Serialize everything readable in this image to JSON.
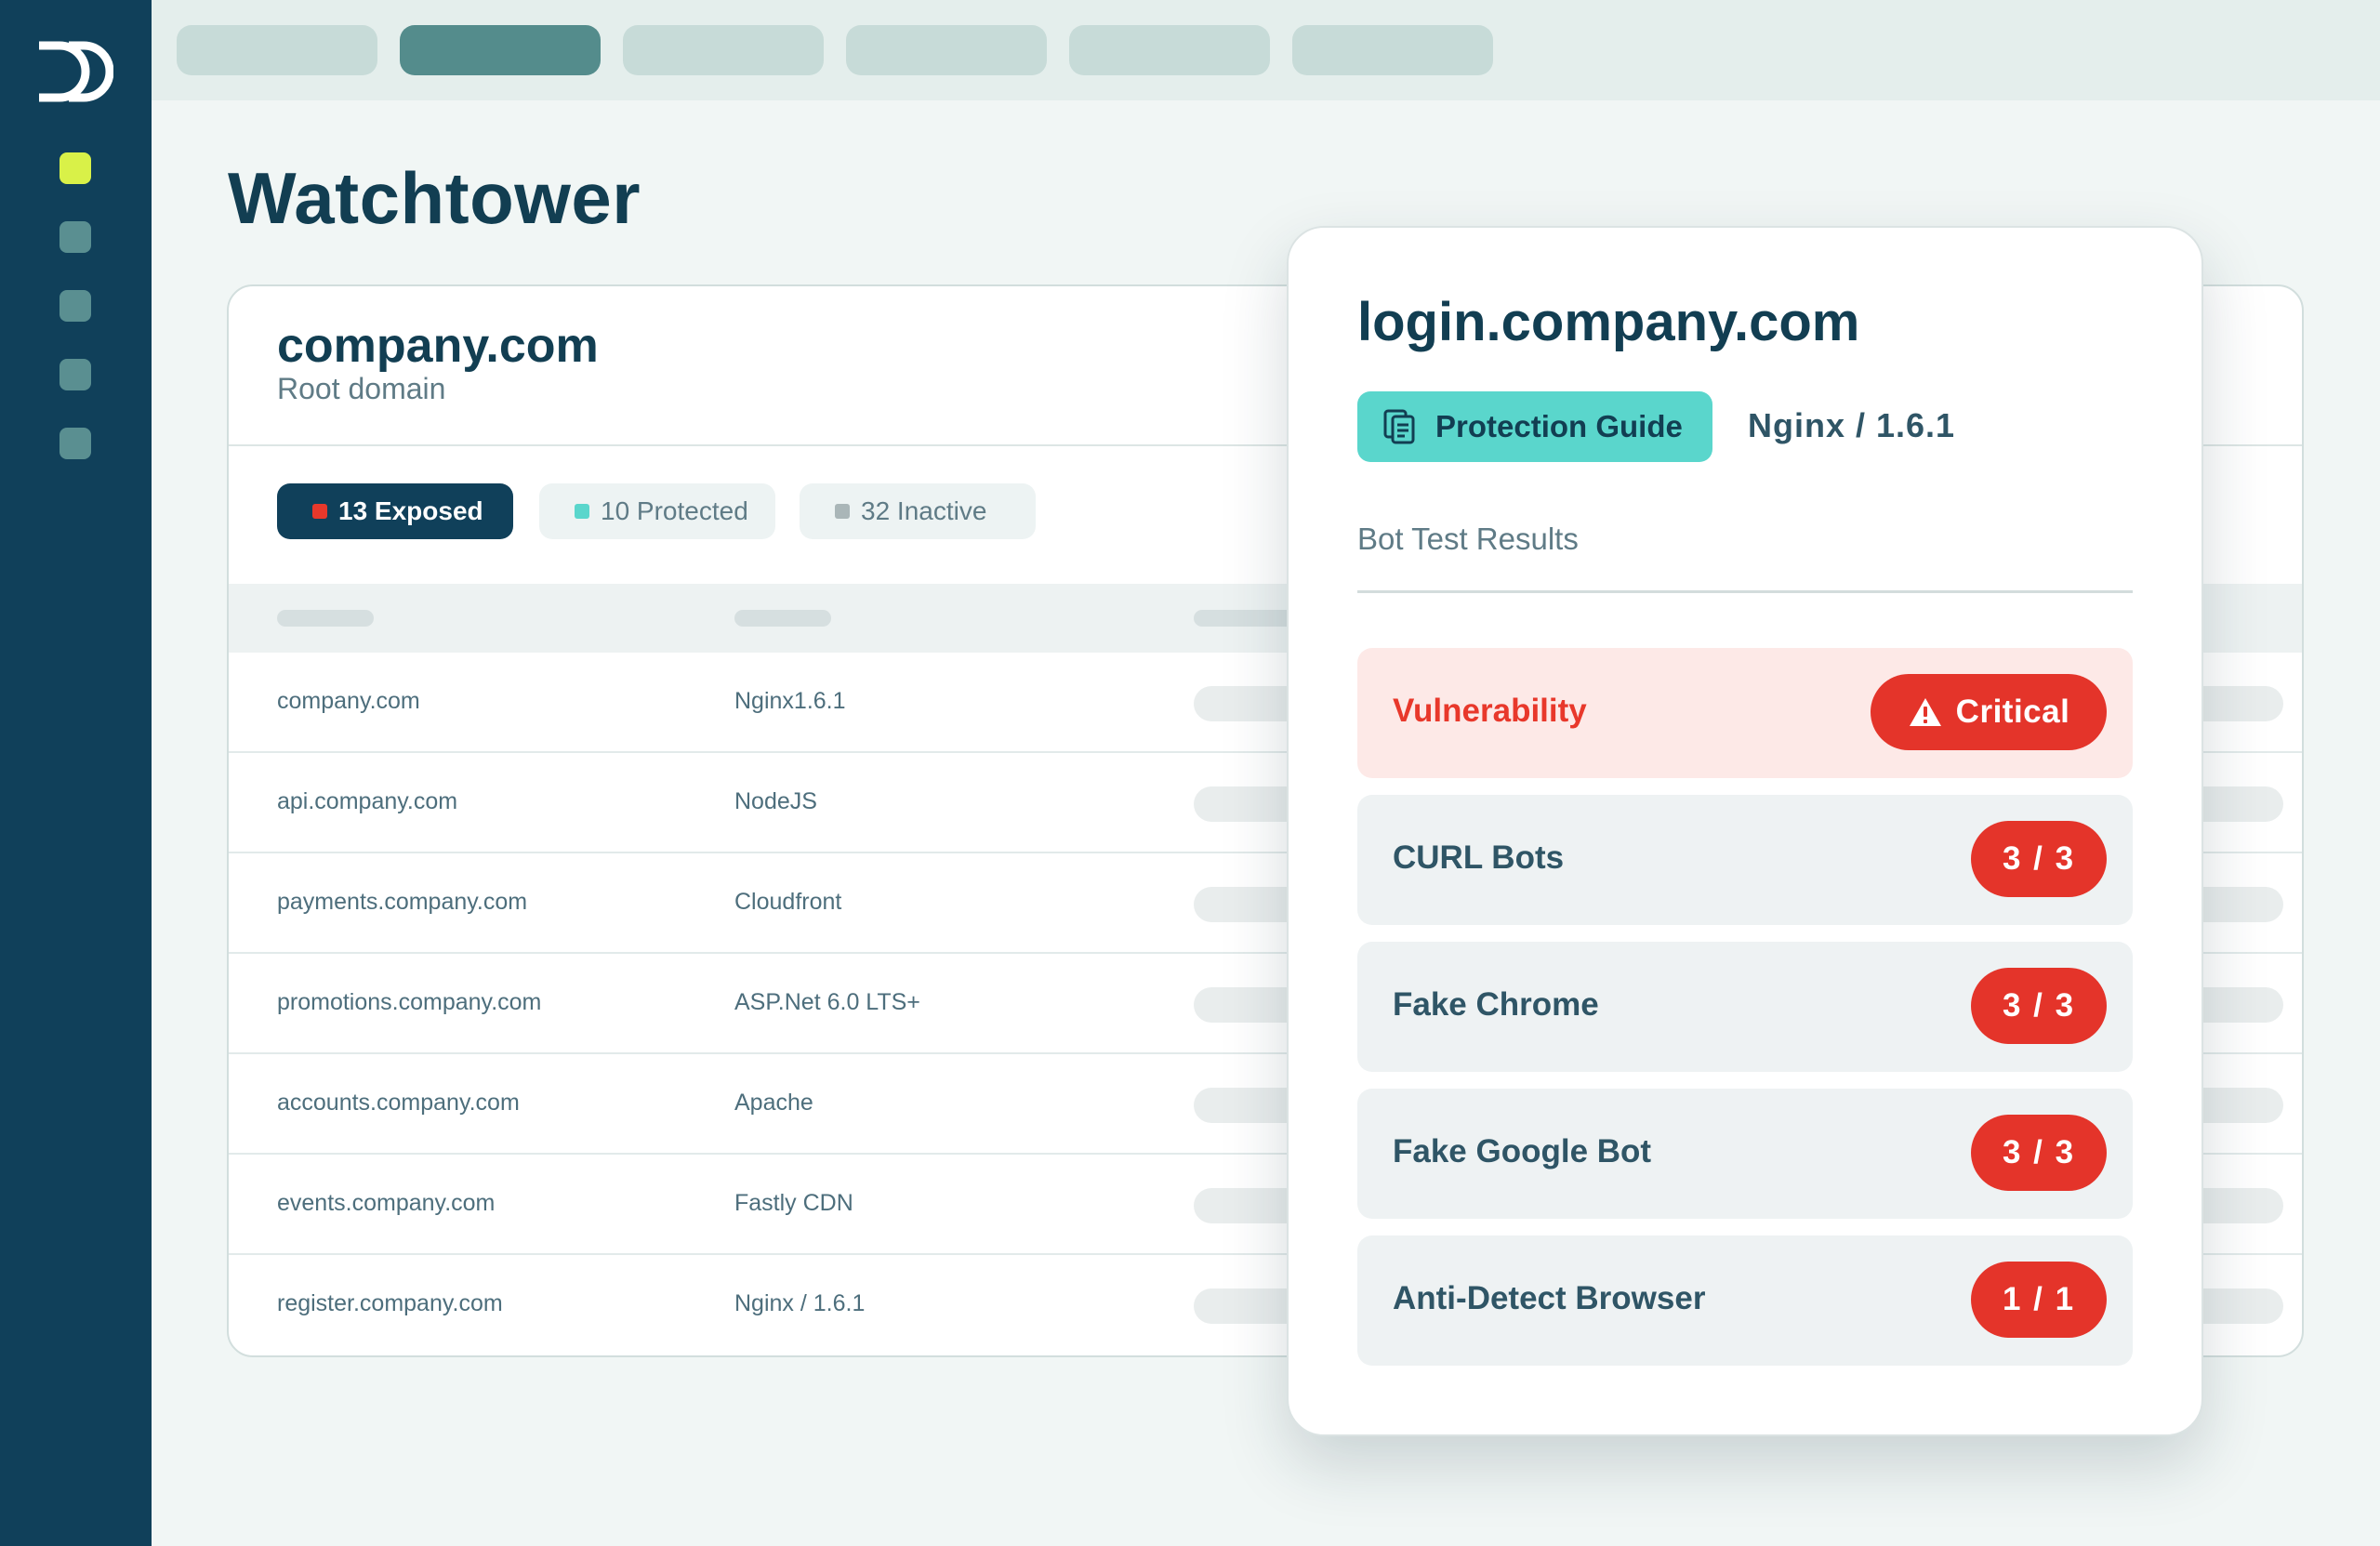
{
  "app": {
    "page_title": "Watchtower",
    "logo_icon": "brand-logo-icon"
  },
  "colors": {
    "sidebar": "#10405a",
    "active_nav": "#d9f148",
    "accent_teal": "#5ad6cc",
    "critical_red": "#e4342a",
    "exposed_dot": "#e8382b",
    "protected_dot": "#5ad6cc",
    "inactive_dot": "#aab6b8"
  },
  "domain_card": {
    "name": "company.com",
    "subtitle": "Root domain",
    "filters": [
      {
        "label": "13 Exposed",
        "status": "exposed"
      },
      {
        "label": "10 Protected",
        "status": "protected"
      },
      {
        "label": "32 Inactive",
        "status": "inactive"
      }
    ],
    "rows": [
      {
        "domain": "company.com",
        "server": "Nginx1.6.1"
      },
      {
        "domain": "api.company.com",
        "server": "NodeJS"
      },
      {
        "domain": "payments.company.com",
        "server": "Cloudfront"
      },
      {
        "domain": "promotions.company.com",
        "server": "ASP.Net 6.0 LTS+"
      },
      {
        "domain": "accounts.company.com",
        "server": "Apache"
      },
      {
        "domain": "events.company.com",
        "server": "Fastly CDN"
      },
      {
        "domain": "register.company.com",
        "server": "Nginx / 1.6.1"
      }
    ]
  },
  "popup": {
    "title": "login.company.com",
    "guide_button": "Protection Guide",
    "guide_icon": "document-icon",
    "server": "Nginx / 1.6.1",
    "section_label": "Bot Test Results",
    "vulnerability": {
      "label": "Vulnerability",
      "badge": "Critical",
      "icon": "warning-icon"
    },
    "results": [
      {
        "label": "CURL Bots",
        "score": "3 / 3"
      },
      {
        "label": "Fake Chrome",
        "score": "3 / 3"
      },
      {
        "label": "Fake Google Bot",
        "score": "3 / 3"
      },
      {
        "label": "Anti-Detect Browser",
        "score": "1 / 1"
      }
    ]
  }
}
